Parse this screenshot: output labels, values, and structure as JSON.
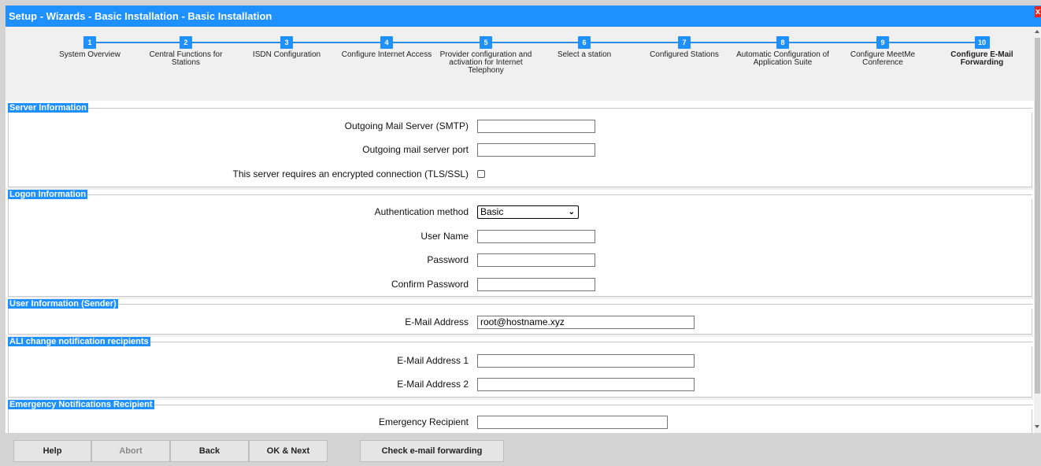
{
  "window": {
    "title": "Setup - Wizards - Basic Installation - Basic Installation"
  },
  "steps": [
    {
      "num": "1",
      "label": "System Overview"
    },
    {
      "num": "2",
      "label": "Central Functions for Stations"
    },
    {
      "num": "3",
      "label": "ISDN Configuration"
    },
    {
      "num": "4",
      "label": "Configure Internet Access"
    },
    {
      "num": "5",
      "label": "Provider configuration and activation for Internet Telephony"
    },
    {
      "num": "6",
      "label": "Select a station"
    },
    {
      "num": "7",
      "label": "Configured Stations"
    },
    {
      "num": "8",
      "label": "Automatic Configuration of Application Suite"
    },
    {
      "num": "9",
      "label": "Configure MeetMe Conference"
    },
    {
      "num": "10",
      "label": "Configure E-Mail Forwarding"
    }
  ],
  "server": {
    "header": "Server Information",
    "smtp_label": "Outgoing Mail Server (SMTP)",
    "smtp_value": "",
    "port_label": "Outgoing mail server port",
    "port_value": "",
    "tls_label": "This server requires an encrypted connection (TLS/SSL)"
  },
  "logon": {
    "header": "Logon Information",
    "auth_label": "Authentication method",
    "auth_value": "Basic",
    "user_label": "User Name",
    "password_label": "Password",
    "confirm_label": "Confirm Password"
  },
  "sender": {
    "header": "User Information (Sender)",
    "email_label": "E-Mail Address",
    "email_value": "root@hostname.xyz"
  },
  "ali": {
    "header": "ALI change notification recipients",
    "email1_label": "E-Mail Address 1",
    "email2_label": "E-Mail Address 2"
  },
  "emergency": {
    "header": "Emergency Notifications Recipient",
    "recipient_label": "Emergency Recipient"
  },
  "buttons": {
    "help": "Help",
    "abort": "Abort",
    "back": "Back",
    "ok_next": "OK & Next",
    "check": "Check e-mail forwarding"
  }
}
